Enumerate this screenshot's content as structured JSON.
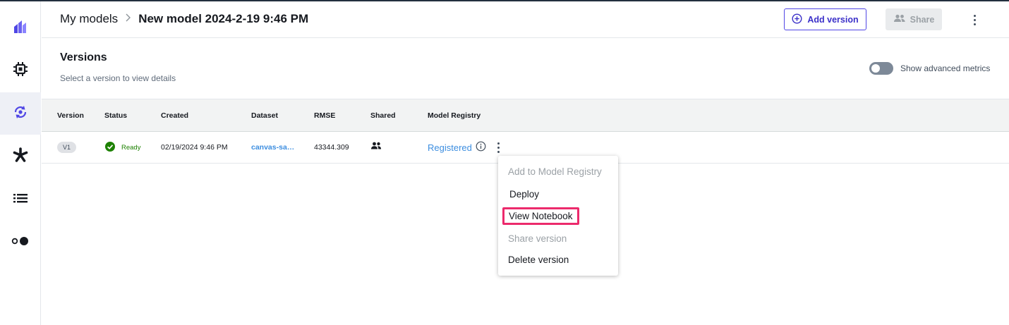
{
  "colors": {
    "accent": "#5046e5",
    "link": "#3d8ee0",
    "ready": "#1d8102",
    "highlight": "#ec2a6c"
  },
  "sidebar": {
    "items": [
      {
        "icon": "canvas-logo-icon"
      },
      {
        "icon": "chip-icon"
      },
      {
        "icon": "models-icon",
        "active": true
      },
      {
        "icon": "flower-icon"
      },
      {
        "icon": "list-icon"
      },
      {
        "icon": "toggle-dots-icon"
      }
    ]
  },
  "header": {
    "breadcrumb_root": "My models",
    "breadcrumb_current": "New model 2024-2-19 9:46 PM",
    "add_version_label": "Add version",
    "share_label": "Share"
  },
  "versions": {
    "title": "Versions",
    "subtitle": "Select a version to view details",
    "toggle_label": "Show advanced metrics"
  },
  "table": {
    "columns": [
      "Version",
      "Status",
      "Created",
      "Dataset",
      "RMSE",
      "Shared",
      "Model Registry"
    ],
    "rows": [
      {
        "version": "V1",
        "status": "Ready",
        "created": "02/19/2024 9:46 PM",
        "dataset": "canvas-sa…",
        "rmse": "43344.309",
        "registry": "Registered"
      }
    ]
  },
  "menu": {
    "items": [
      "Add to Model Registry",
      "Deploy",
      "View Notebook",
      "Share version",
      "Delete version"
    ]
  }
}
